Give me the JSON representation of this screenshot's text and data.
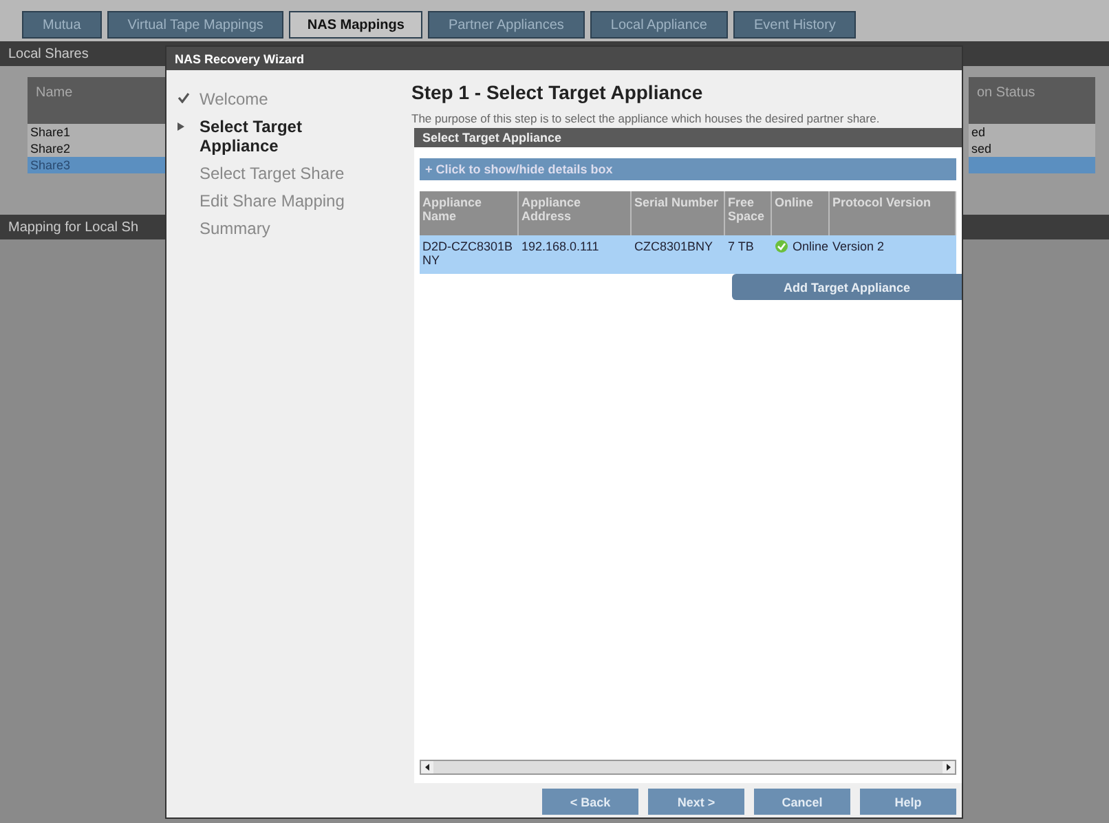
{
  "tabs": [
    {
      "label": "Mutua",
      "selected": false
    },
    {
      "label": "Virtual Tape Mappings",
      "selected": false
    },
    {
      "label": "NAS Mappings",
      "selected": true
    },
    {
      "label": "Partner Appliances",
      "selected": false
    },
    {
      "label": "Local Appliance",
      "selected": false
    },
    {
      "label": "Event History",
      "selected": false
    }
  ],
  "local_shares": {
    "title": "Local Shares",
    "column_1": "Name",
    "column_2": "on Status",
    "rows": [
      {
        "name": "Share1",
        "status": "ed",
        "selected": false
      },
      {
        "name": "Share2",
        "status": "sed",
        "selected": false
      },
      {
        "name": "Share3",
        "status": "",
        "selected": true
      }
    ]
  },
  "mapping_panel": {
    "title": "Mapping for Local Sh"
  },
  "wizard": {
    "title": "NAS Recovery Wizard",
    "steps": [
      {
        "label": "Welcome",
        "done": true,
        "selected": false
      },
      {
        "label": "Select Target Appliance",
        "done": false,
        "selected": true
      },
      {
        "label": "Select Target Share",
        "done": false,
        "selected": false
      },
      {
        "label": "Edit Share Mapping",
        "done": false,
        "selected": false
      },
      {
        "label": "Summary",
        "done": false,
        "selected": false
      }
    ],
    "heading": "Step 1 - Select Target Appliance",
    "description": "The purpose of this step is to select the appliance which houses the desired partner share.",
    "panel_title": "Select Target Appliance",
    "details_toggle": "+ Click to show/hide details box",
    "columns": [
      "Appliance Name",
      "Appliance Address",
      "Serial Number",
      "Free Space",
      "Online",
      "Protocol Version"
    ],
    "rows": [
      {
        "name": "D2D-CZC8301BNY",
        "address": "192.168.0.111",
        "serial": "CZC8301BNY",
        "free_space": "7 TB",
        "online": true,
        "online_label": "Online",
        "protocol": "Version 2",
        "selected": true
      }
    ],
    "add_button": "Add Target Appliance",
    "buttons": [
      "< Back",
      "Next >",
      "Cancel",
      "Help"
    ]
  }
}
